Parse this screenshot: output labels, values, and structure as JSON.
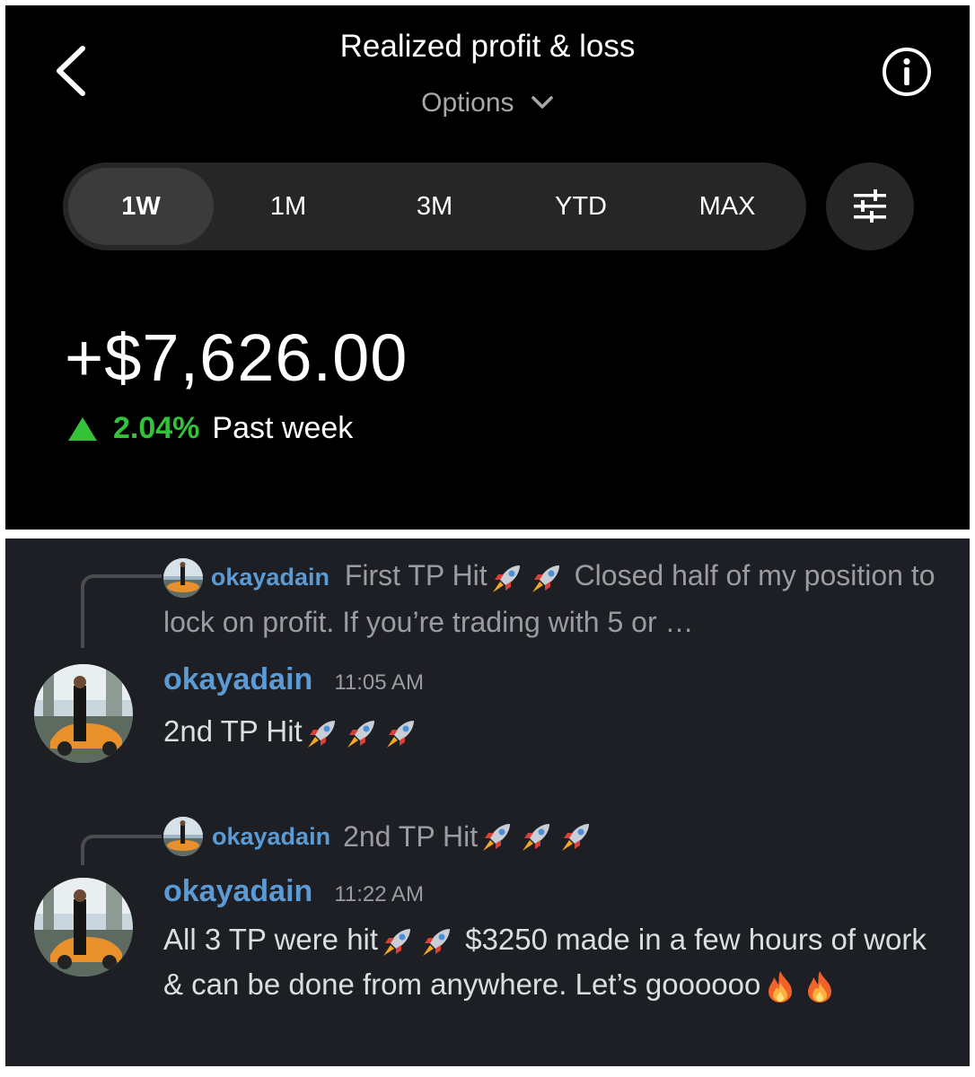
{
  "pnl": {
    "title": "Realized profit & loss",
    "subtitle": "Options",
    "ranges": [
      "1W",
      "1M",
      "3M",
      "YTD",
      "MAX"
    ],
    "active_range": "1W",
    "amount": "+$7,626.00",
    "change_pct": "2.04%",
    "change_period": "Past week",
    "colors": {
      "gain": "#34c23b",
      "background": "#000000",
      "pill": "#262626"
    },
    "icons": [
      "back-arrow-icon",
      "chevron-down-icon",
      "info-icon",
      "sliders-icon"
    ]
  },
  "chat": {
    "reply1": {
      "user": "okayadain",
      "text_a": "First TP Hit",
      "text_b": " Closed half of my position to lock on profit. If you’re trading with 5 or …"
    },
    "msg1": {
      "user": "okayadain",
      "time": "11:05 AM",
      "text": "2nd TP Hit"
    },
    "reply2": {
      "user": "okayadain",
      "text": "2nd TP Hit"
    },
    "msg2": {
      "user": "okayadain",
      "time": "11:22 AM",
      "text_a": "All 3 TP were hit",
      "text_b": " $3250 made in a few hours of work & can be done from anywhere. Let’s goooooo"
    },
    "colors": {
      "username": "#5b9bd5",
      "background": "#1e1f24",
      "muted": "#9a9ca2"
    },
    "icons": [
      "rocket-emoji-icon",
      "fire-emoji-icon",
      "avatar"
    ]
  }
}
